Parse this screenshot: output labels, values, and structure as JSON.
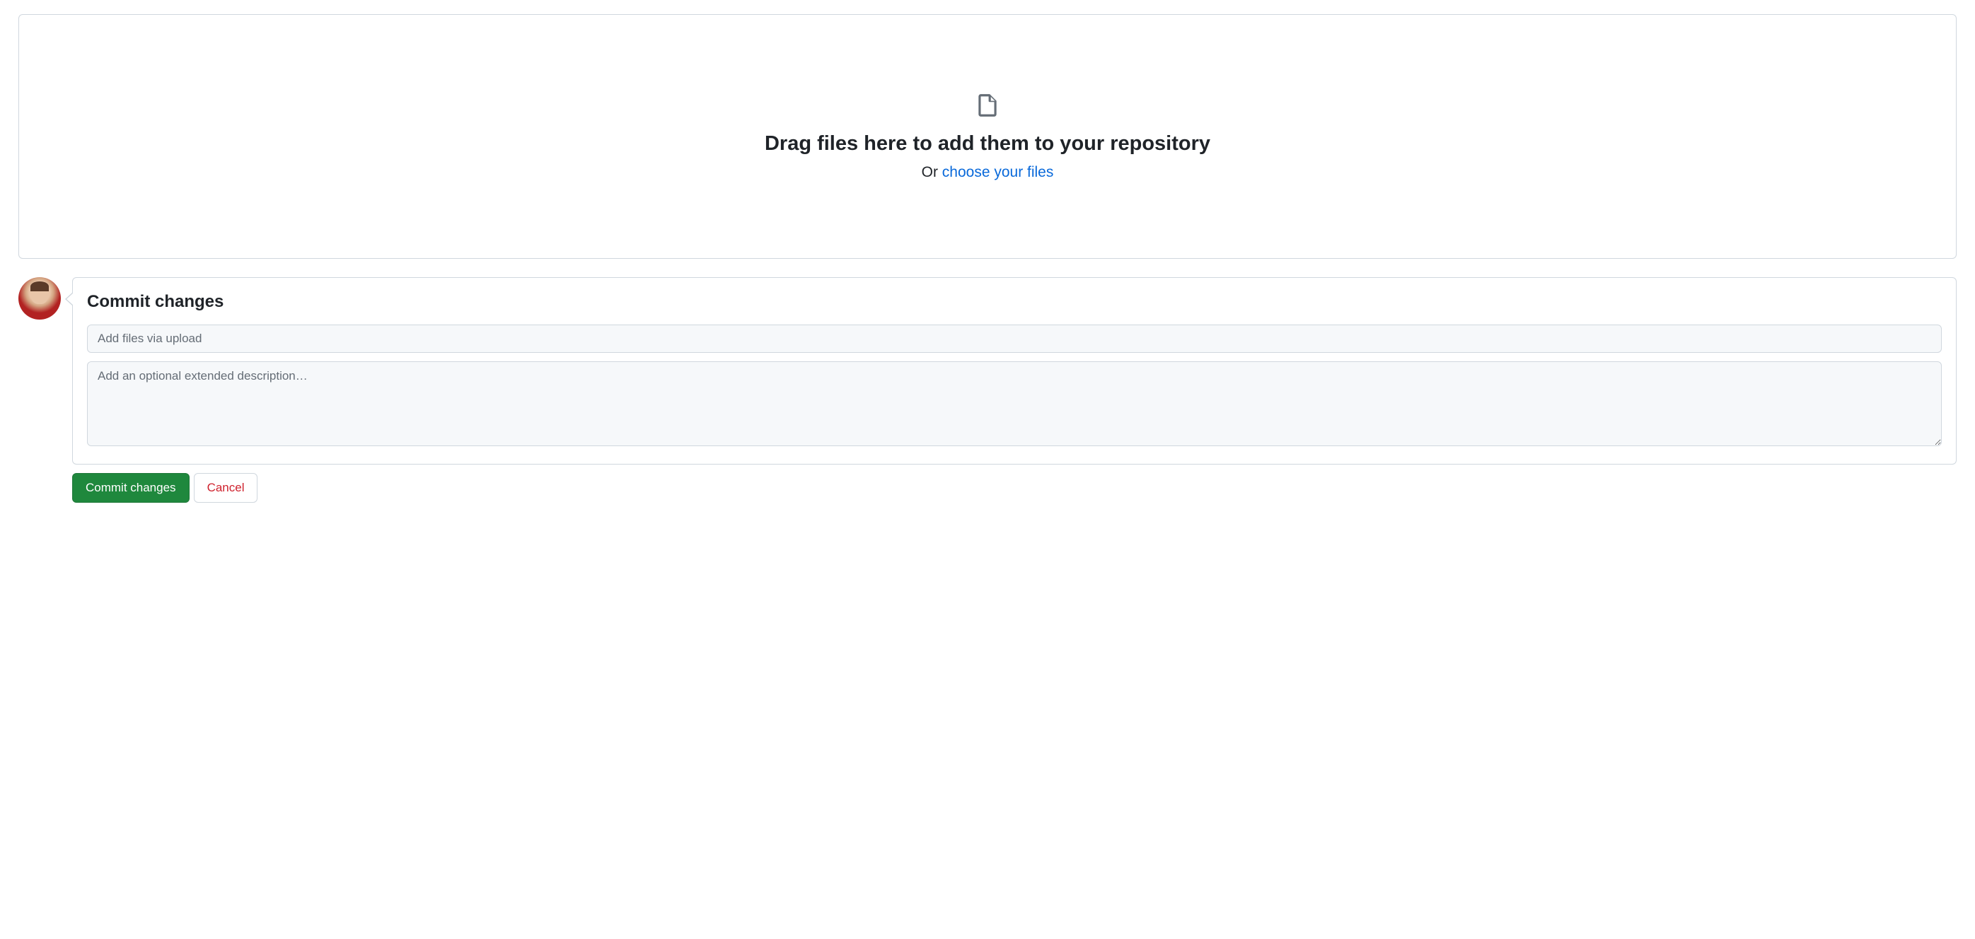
{
  "dropzone": {
    "title": "Drag files here to add them to your repository",
    "or_text": "Or ",
    "choose_link": "choose your files"
  },
  "commit": {
    "heading": "Commit changes",
    "summary_placeholder": "Add files via upload",
    "description_placeholder": "Add an optional extended description…",
    "commit_button": "Commit changes",
    "cancel_button": "Cancel"
  }
}
